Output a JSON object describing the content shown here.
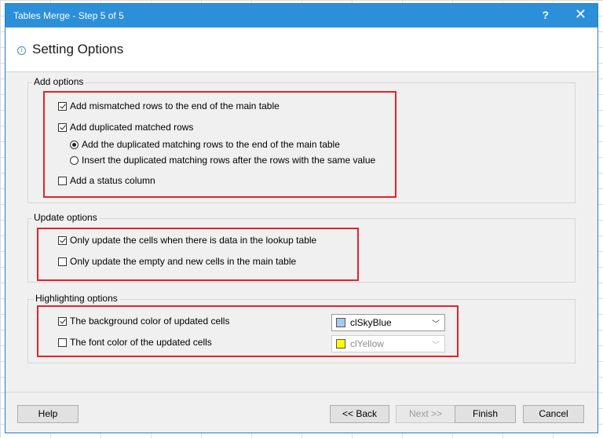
{
  "window": {
    "title": "Tables Merge - Step 5 of 5",
    "help_glyph": "?",
    "close_glyph": "✕"
  },
  "header": {
    "info_glyph": "i",
    "title": "Setting Options"
  },
  "add_options": {
    "title": "Add options",
    "add_mismatched": {
      "label": "Add mismatched rows to the end of the main table",
      "checked": true
    },
    "add_duplicated": {
      "label": "Add duplicated matched rows",
      "checked": true
    },
    "dup_to_end": {
      "label": "Add the duplicated matching rows to the end of the main table",
      "selected": true
    },
    "dup_after_same": {
      "label": "Insert the duplicated matching rows after the rows with the same value",
      "selected": false
    },
    "add_status": {
      "label": "Add a status column",
      "checked": false
    }
  },
  "update_options": {
    "title": "Update options",
    "only_lookup_data": {
      "label": "Only update the cells when there is data in the lookup table",
      "checked": true
    },
    "only_empty_new": {
      "label": "Only update the empty and new cells in the main table",
      "checked": false
    }
  },
  "highlighting_options": {
    "title": "Highlighting options",
    "background_color": {
      "label": "The background color of updated cells",
      "checked": true,
      "value": "clSkyBlue",
      "swatch": "#a6caf0"
    },
    "font_color": {
      "label": "The font color of the updated cells",
      "checked": false,
      "value": "clYellow",
      "swatch": "#ffff00"
    }
  },
  "buttons": {
    "help": "Help",
    "back": "<< Back",
    "next": "Next >>",
    "finish": "Finish",
    "cancel": "Cancel"
  },
  "colors": {
    "title_bar": "#2b8fd9",
    "highlight_box": "#e0242a"
  }
}
